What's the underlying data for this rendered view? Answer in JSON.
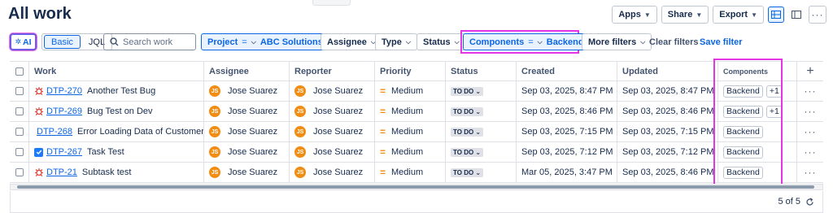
{
  "page": {
    "title": "All work"
  },
  "top_actions": {
    "apps": "Apps",
    "share": "Share",
    "export": "Export"
  },
  "filters": {
    "ai_label": "AI",
    "mode_basic": "Basic",
    "mode_jql": "JQL",
    "search_placeholder": "Search work",
    "project": {
      "label": "Project",
      "op": "=",
      "value": "ABC Solutions"
    },
    "assignee": "Assignee",
    "type": "Type",
    "status": "Status",
    "components": {
      "label": "Components",
      "op": "=",
      "value": "Backend"
    },
    "more": "More filters",
    "clear": "Clear filters",
    "save": "Save filter"
  },
  "columns": {
    "work": "Work",
    "assignee": "Assignee",
    "reporter": "Reporter",
    "priority": "Priority",
    "status": "Status",
    "created": "Created",
    "updated": "Updated",
    "components": "Components"
  },
  "rows": [
    {
      "type": "bug",
      "key": "DTP-270",
      "summary": "Another Test Bug",
      "assignee": "Jose Suarez",
      "assignee_initials": "JS",
      "reporter": "Jose Suarez",
      "reporter_initials": "JS",
      "priority": "Medium",
      "status": "TO DO",
      "created": "Sep 03, 2025, 8:47 PM",
      "updated": "Sep 03, 2025, 8:47 PM",
      "component": "Backend",
      "extra": "+1"
    },
    {
      "type": "bug",
      "key": "DTP-269",
      "summary": "Bug Test on Dev",
      "assignee": "Jose Suarez",
      "assignee_initials": "JS",
      "reporter": "Jose Suarez",
      "reporter_initials": "JS",
      "priority": "Medium",
      "status": "TO DO",
      "created": "Sep 03, 2025, 8:46 PM",
      "updated": "Sep 03, 2025, 8:46 PM",
      "component": "Backend",
      "extra": "+1"
    },
    {
      "type": "bug",
      "key": "DTP-268",
      "summary": "Error Loading Data of Customer",
      "assignee": "Jose Suarez",
      "assignee_initials": "JS",
      "reporter": "Jose Suarez",
      "reporter_initials": "JS",
      "priority": "Medium",
      "status": "TO DO",
      "created": "Sep 03, 2025, 7:15 PM",
      "updated": "Sep 03, 2025, 7:15 PM",
      "component": "Backend",
      "extra": ""
    },
    {
      "type": "task",
      "key": "DTP-267",
      "summary": "Task Test",
      "assignee": "Jose Suarez",
      "assignee_initials": "JS",
      "reporter": "Jose Suarez",
      "reporter_initials": "JS",
      "priority": "Medium",
      "status": "TO DO",
      "created": "Sep 03, 2025, 7:12 PM",
      "updated": "Sep 03, 2025, 7:12 PM",
      "component": "Backend",
      "extra": ""
    },
    {
      "type": "bug",
      "key": "DTP-21",
      "summary": "Subtask test",
      "assignee": "Jose Suarez",
      "assignee_initials": "JS",
      "reporter": "Jose Suarez",
      "reporter_initials": "JS",
      "priority": "Medium",
      "status": "TO DO",
      "created": "Mar 05, 2025, 3:47 PM",
      "updated": "Sep 03, 2025, 8:46 PM",
      "component": "Backend",
      "extra": ""
    }
  ],
  "pagination": {
    "text": "5 of 5"
  },
  "colors": {
    "accent": "#0c66e4",
    "highlight": "#e536e5",
    "bug": "#e2483d",
    "avatar": "#f18d13"
  }
}
